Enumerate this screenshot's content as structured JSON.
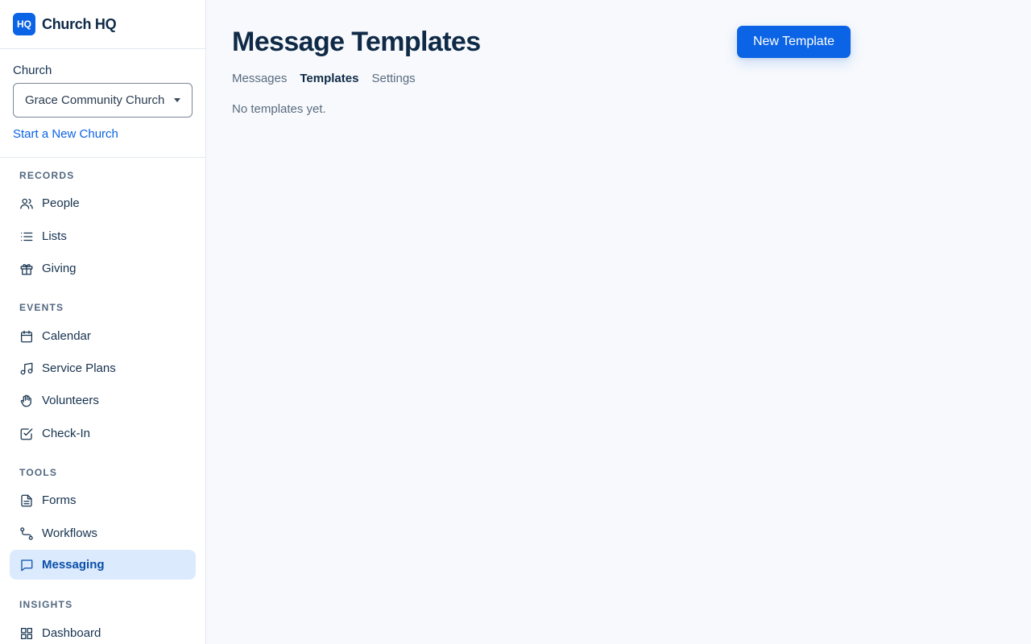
{
  "brand": {
    "logo_text": "HQ",
    "name": "Church HQ"
  },
  "church": {
    "label": "Church",
    "selected": "Grace Community Church (",
    "start_link": "Start a New Church"
  },
  "nav": {
    "sections": [
      {
        "title": "RECORDS",
        "items": [
          {
            "label": "People",
            "icon": "people-icon"
          },
          {
            "label": "Lists",
            "icon": "list-icon"
          },
          {
            "label": "Giving",
            "icon": "gift-icon"
          }
        ]
      },
      {
        "title": "EVENTS",
        "items": [
          {
            "label": "Calendar",
            "icon": "calendar-icon"
          },
          {
            "label": "Service Plans",
            "icon": "music-note-icon"
          },
          {
            "label": "Volunteers",
            "icon": "hand-icon"
          },
          {
            "label": "Check-In",
            "icon": "checkbox-icon"
          }
        ]
      },
      {
        "title": "TOOLS",
        "items": [
          {
            "label": "Forms",
            "icon": "document-icon"
          },
          {
            "label": "Workflows",
            "icon": "workflow-icon"
          },
          {
            "label": "Messaging",
            "icon": "message-icon",
            "active": true
          }
        ]
      },
      {
        "title": "INSIGHTS",
        "items": [
          {
            "label": "Dashboard",
            "icon": "dashboard-icon"
          }
        ]
      }
    ]
  },
  "main": {
    "title": "Message Templates",
    "new_button": "New Template",
    "tabs": [
      {
        "label": "Messages"
      },
      {
        "label": "Templates",
        "active": true
      },
      {
        "label": "Settings"
      }
    ],
    "empty_text": "No templates yet."
  },
  "colors": {
    "accent": "#0b63e5",
    "active_bg": "#dceafd",
    "text": "#16324f"
  }
}
